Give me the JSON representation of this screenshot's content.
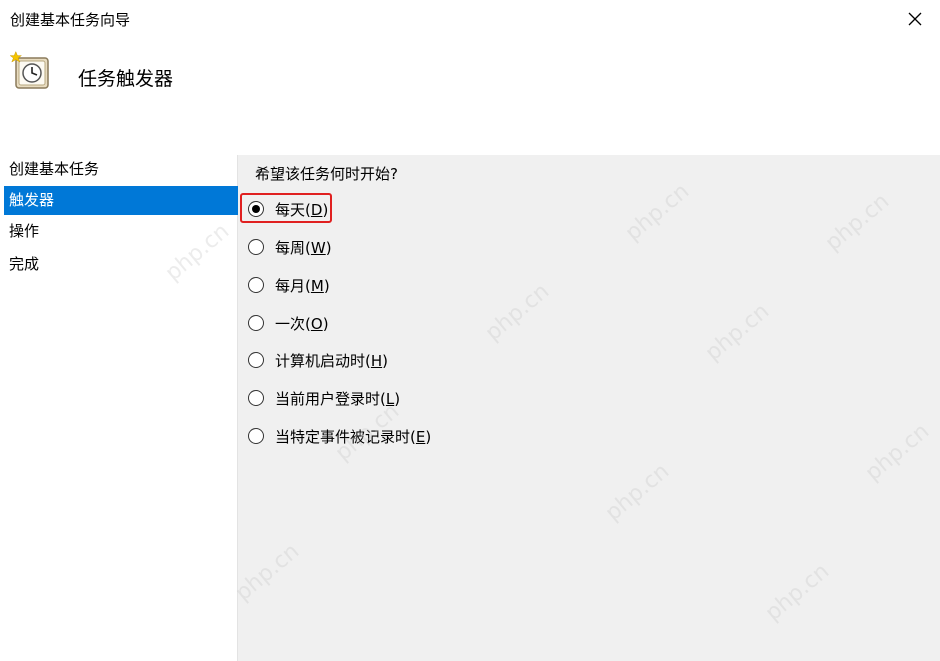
{
  "window": {
    "title": "创建基本任务向导",
    "close_icon": "close-icon"
  },
  "header": {
    "title": "任务触发器",
    "icon": "clock-wizard-icon"
  },
  "steps": [
    {
      "label": "创建基本任务",
      "active": false
    },
    {
      "label": "触发器",
      "active": true
    },
    {
      "label": "操作",
      "active": false
    },
    {
      "label": "完成",
      "active": false
    }
  ],
  "main": {
    "question": "希望该任务何时开始?",
    "options": [
      {
        "label": "每天",
        "key": "D",
        "selected": true
      },
      {
        "label": "每周",
        "key": "W",
        "selected": false
      },
      {
        "label": "每月",
        "key": "M",
        "selected": false
      },
      {
        "label": "一次",
        "key": "O",
        "selected": false
      },
      {
        "label": "计算机启动时",
        "key": "H",
        "selected": false
      },
      {
        "label": "当前用户登录时",
        "key": "L",
        "selected": false
      },
      {
        "label": "当特定事件被记录时",
        "key": "E",
        "selected": false
      }
    ]
  },
  "colors": {
    "selection": "#0078d7",
    "highlight_box": "#e02020",
    "background": "#f0f0f0"
  },
  "watermark_text": "php.cn"
}
